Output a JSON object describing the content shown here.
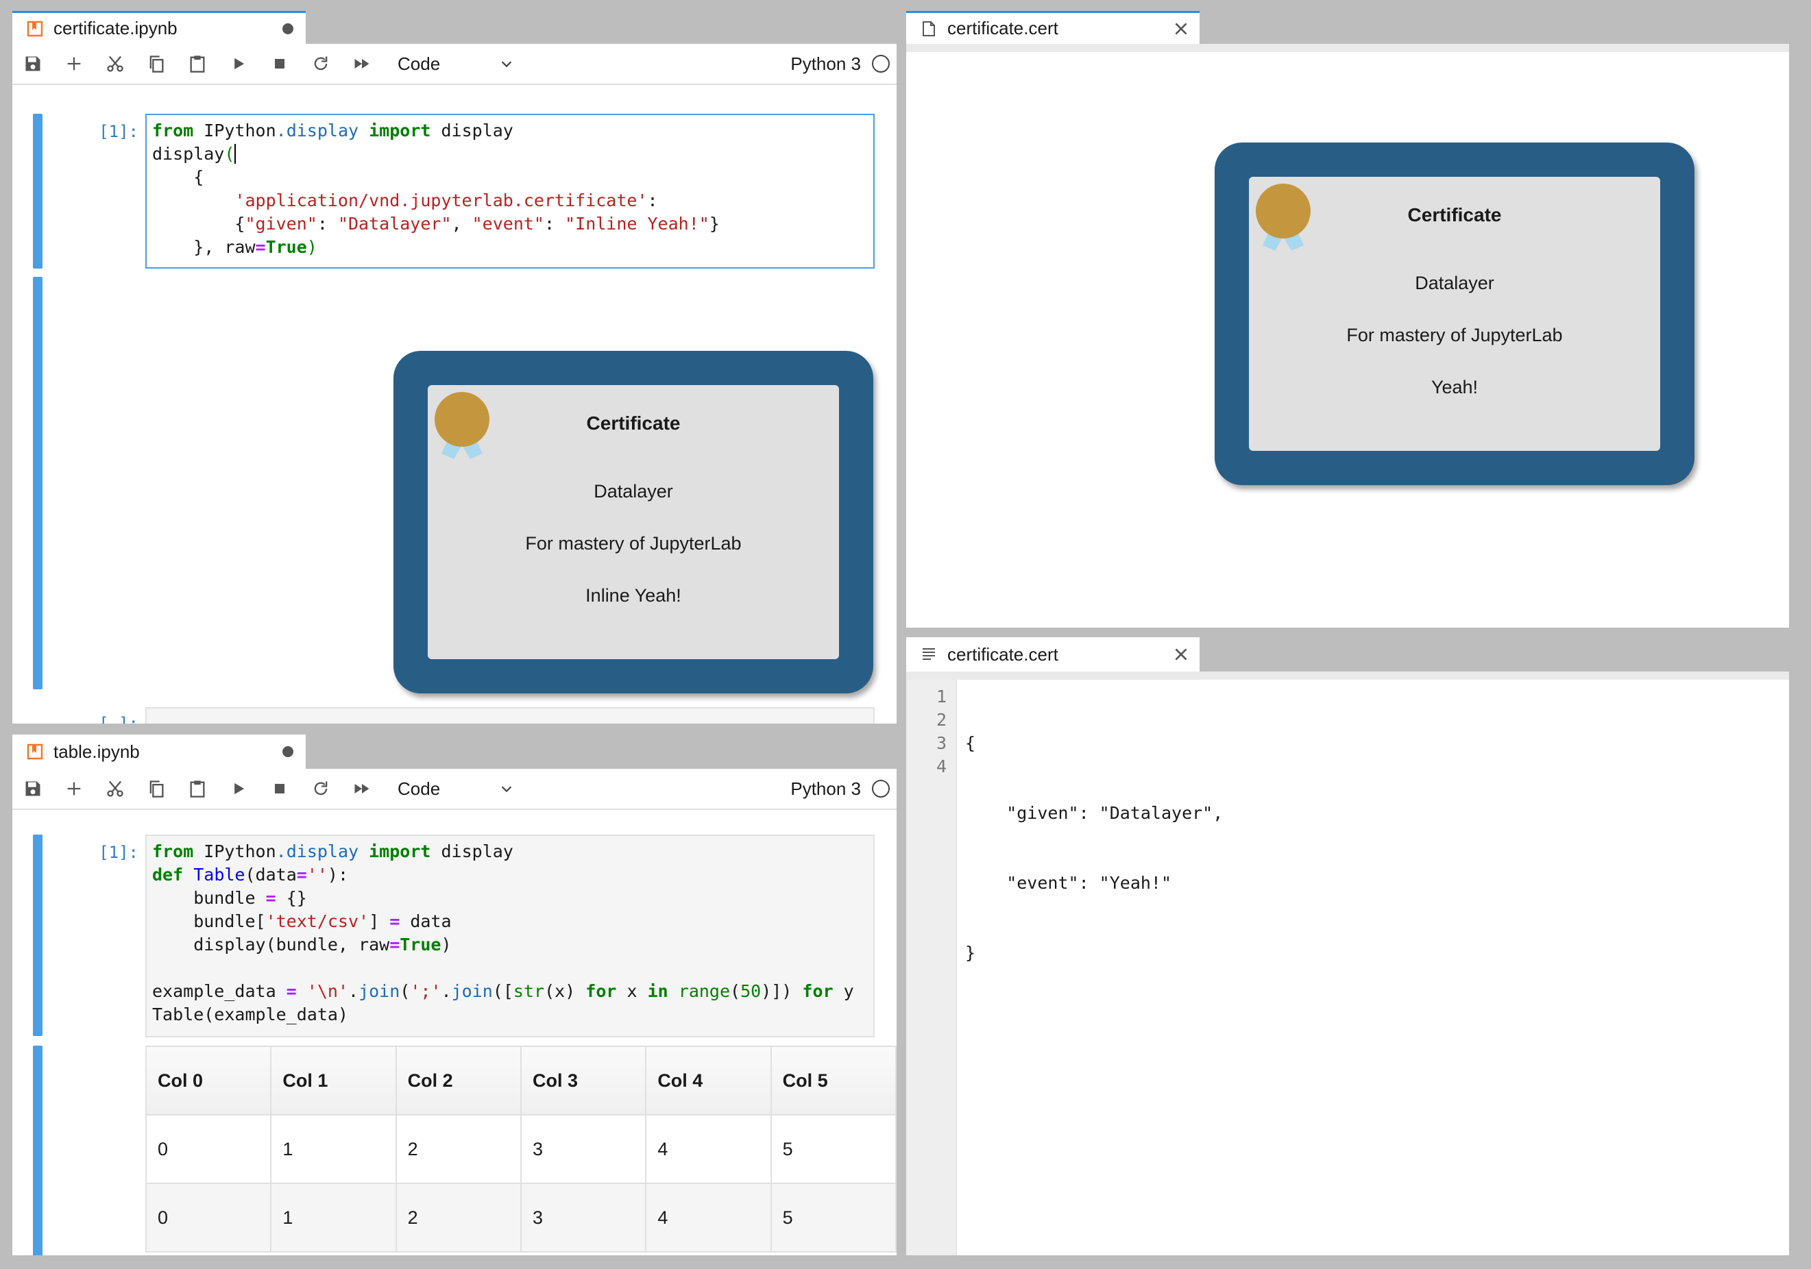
{
  "certificate_notebook": {
    "tab_label": "certificate.ipynb",
    "cell_type": "Code",
    "kernel": "Python 3",
    "cell1_prompt": "[1]:",
    "cell2_prompt": "[ ]:",
    "output_certificate": {
      "title": "Certificate",
      "name": "Datalayer",
      "reason": "For mastery of JupyterLab",
      "event": "Inline Yeah!"
    }
  },
  "table_notebook": {
    "tab_label": "table.ipynb",
    "cell_type": "Code",
    "kernel": "Python 3",
    "cell1_prompt": "[1]:",
    "table": {
      "headers": [
        "Col 0",
        "Col 1",
        "Col 2",
        "Col 3",
        "Col 4",
        "Col 5"
      ],
      "rows": [
        [
          "0",
          "1",
          "2",
          "3",
          "4",
          "5"
        ],
        [
          "0",
          "1",
          "2",
          "3",
          "4",
          "5"
        ]
      ]
    }
  },
  "cert_viewer": {
    "tab_label": "certificate.cert",
    "certificate": {
      "title": "Certificate",
      "name": "Datalayer",
      "reason": "For mastery of JupyterLab",
      "event": "Yeah!"
    }
  },
  "cert_editor": {
    "tab_label": "certificate.cert",
    "line_numbers": [
      "1",
      "2",
      "3",
      "4"
    ],
    "lines": [
      "{",
      "    \"given\": \"Datalayer\",",
      "    \"event\": \"Yeah!\"",
      "}"
    ]
  },
  "colors": {
    "accent": "#4a9ee5",
    "certificate_frame": "#285e86",
    "certificate_seal": "#c4973f",
    "ribbon": "#a8d8ef"
  }
}
